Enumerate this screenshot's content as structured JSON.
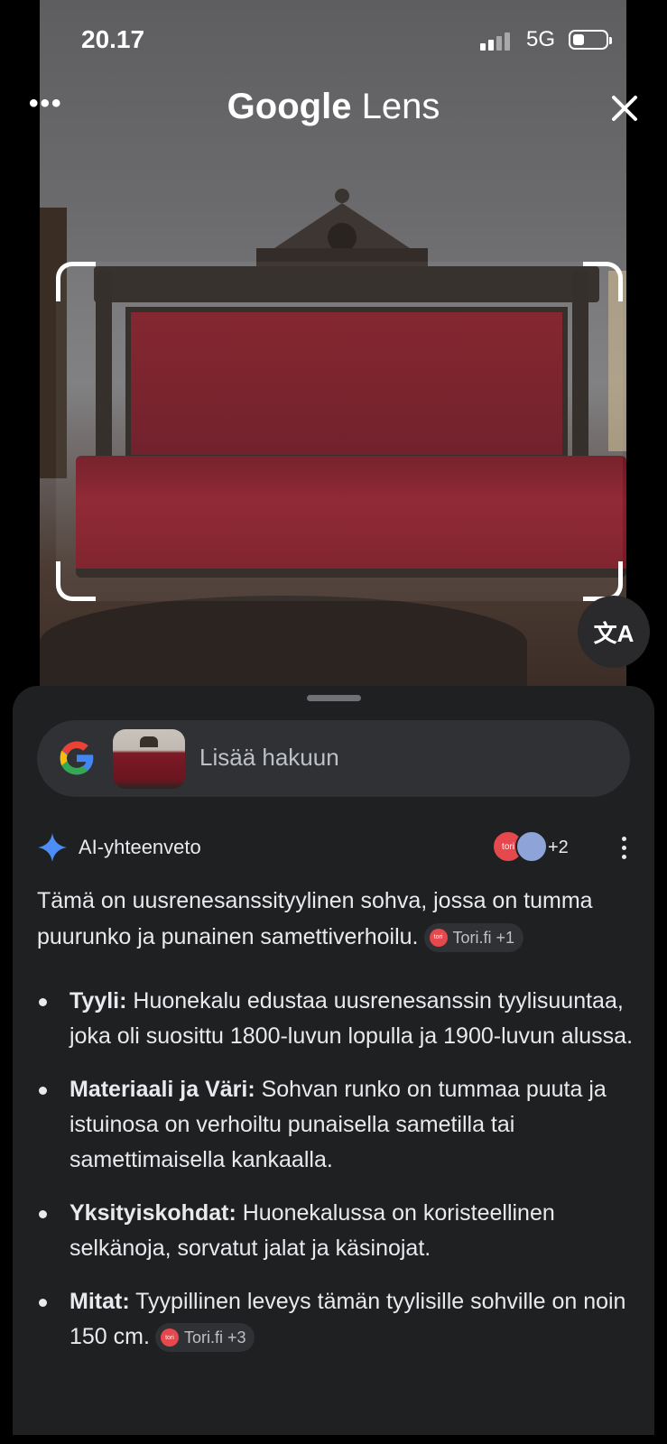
{
  "status_bar": {
    "time": "20.17",
    "network": "5G"
  },
  "header": {
    "title_brand": "Google",
    "title_product": "Lens"
  },
  "translate_button": {
    "label": "文A"
  },
  "search": {
    "placeholder": "Lisää hakuun"
  },
  "ai_overview": {
    "title": "AI-yhteenveto",
    "source_avatar_label": "tori",
    "source_count": "+2",
    "summary": "Tämä on uusrenesanssityylinen sohva, jossa on tumma puurunko ja punainen samettiverhoilu.",
    "summary_chip": {
      "dot": "tori",
      "label": "Tori.fi +1"
    },
    "bullets": [
      {
        "term": "Tyyli:",
        "text": " Huonekalu edustaa uusrenesanssin tyylisuuntaa, joka oli suosittu 1800-luvun lopulla ja 1900-luvun alussa."
      },
      {
        "term": "Materiaali ja Väri:",
        "text": " Sohvan runko on tummaa puuta ja istuinosa on verhoiltu punaisella sametilla tai samettimaisella kankaalla."
      },
      {
        "term": "Yksityiskohdat:",
        "text": " Huonekalussa on koristeellinen selkänoja, sorvatut jalat ja käsinojat."
      },
      {
        "term": "Mitat:",
        "text": " Tyypillinen leveys tämän tyylisille sohville on noin 150 cm."
      }
    ],
    "last_chip": {
      "dot": "tori",
      "label": "Tori.fi +3"
    }
  },
  "colors": {
    "sheet_bg": "#1f2022",
    "search_bg": "#303134",
    "accent_blue": "#4285f4",
    "tori_red": "#e5484d",
    "sofa_red": "#7d1a24"
  }
}
